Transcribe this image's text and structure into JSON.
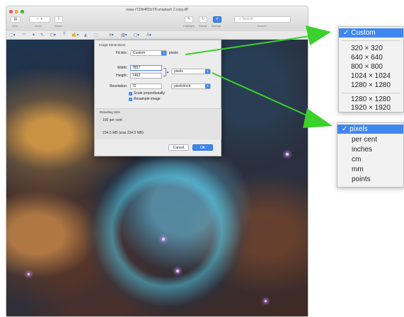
{
  "window": {
    "title": "nasa-rTZW4f02zY8-unsplash 2 copy.tiff",
    "toolbar": {
      "view_label": "View",
      "zoom_label": "Zoom",
      "share_label": "Share",
      "highlight_label": "Highlight",
      "rotate_label": "Rotate",
      "markup_label": "Markup",
      "search_placeholder": "Search",
      "search_caption": "Search"
    }
  },
  "dialog": {
    "heading": "Image Dimensions",
    "fit_into_label": "Fit into:",
    "fit_into_value": "Custom",
    "fit_into_unit": "pixels",
    "width_label": "Width:",
    "width_value": "7857",
    "height_label": "Height:",
    "height_value": "7462",
    "size_unit": "pixels",
    "resolution_label": "Resolution:",
    "resolution_value": "72",
    "resolution_unit": "pixels/inch",
    "scale_label": "Scale proportionally",
    "resample_label": "Resample image",
    "resulting_size_label": "Resulting Size",
    "percent_text": "100 per cent",
    "size_text": "234.5 MB (was 234.5 MB)",
    "cancel_label": "Cancel",
    "ok_label": "OK"
  },
  "fit_menu": {
    "items": [
      "Custom",
      "320 × 320",
      "640 × 640",
      "800 × 800",
      "1024 × 1024",
      "1280 × 1280",
      "1280 × 1280",
      "1920 × 1920"
    ],
    "selected": "✓ Custom"
  },
  "unit_menu": {
    "items": [
      "pixels",
      "per cent",
      "inches",
      "cm",
      "mm",
      "points"
    ],
    "selected": "✓ pixels"
  },
  "colors": {
    "accent": "#3f87ef",
    "arrow": "#3bd12b",
    "star": "#e6c4ff"
  }
}
